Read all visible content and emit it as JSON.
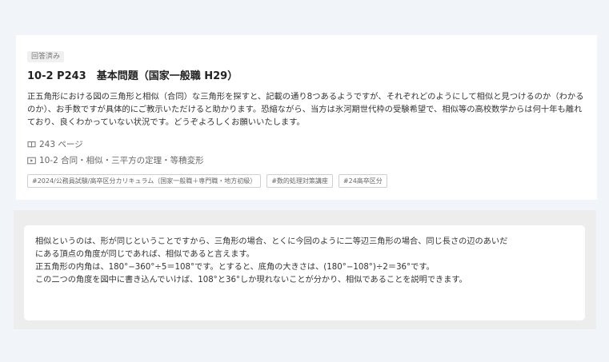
{
  "question": {
    "status_badge": "回答済み",
    "title": "10-2 P243　基本問題（国家一般職 H29）",
    "body": "正五角形における図の三角形と相似（合同）な三角形を探すと、記載の通り8つあるようですが、それぞれどのようにして相似と見つけるのか（わかるのか）、お手数ですが具体的にご教示いただけると助かります。恐縮ながら、当方は氷河期世代枠の受験希望で、相似等の高校数学からは何十年も離れており、良くわかっていない状況です。どうぞよろしくお願いいたします。",
    "page": "243 ページ",
    "page_icon": "book-icon",
    "lesson": "10-2 合同・相似・三平方の定理・等積変形",
    "lesson_icon": "video-play-icon",
    "tags": [
      "#2024/公務員試験/高卒区分カリキュラム（国家一般職＋専門職・地方初級）",
      "#数的処理対策講座",
      "#24高卒区分"
    ]
  },
  "answer": {
    "lines": [
      "相似というのは、形が同じということですから、三角形の場合、とくに今回のように二等辺三角形の場合、同じ長さの辺のあいだ",
      "にある頂点の角度が同じであれば、相似であると言えます。",
      "正五角形の内角は、180°−360°÷5＝108°です。とすると、底角の大きさは、(180°−108°)÷2＝36°です。",
      "この二つの角度を図中に書き込んでいけば、108°と36°しか現れないことが分かり、相似であることを説明できます。"
    ]
  }
}
